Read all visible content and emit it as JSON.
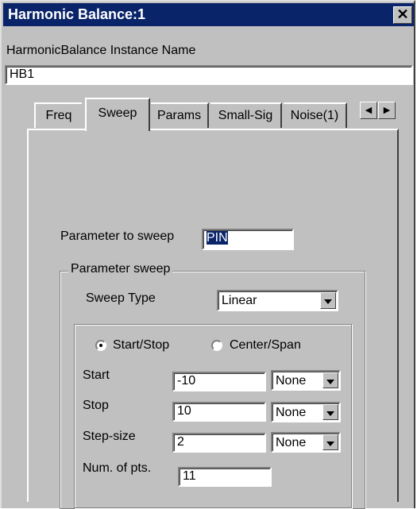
{
  "window": {
    "title": "Harmonic Balance:1",
    "close_glyph": "✕"
  },
  "instance": {
    "label": "HarmonicBalance Instance Name",
    "value": "HB1"
  },
  "tabs": {
    "items": [
      "Freq",
      "Sweep",
      "Params",
      "Small-Sig",
      "Noise(1)"
    ],
    "active": "Sweep",
    "scroll_left": "◀",
    "scroll_right": "▶"
  },
  "sweep": {
    "param_label": "Parameter to sweep",
    "param_value": "PIN",
    "group_title": "Parameter sweep",
    "type_label": "Sweep Type",
    "type_value": "Linear",
    "mode_options": [
      "Start/Stop",
      "Center/Span"
    ],
    "mode_selected": "Start/Stop",
    "rows": [
      {
        "label": "Start",
        "value": "-10",
        "unit": "None"
      },
      {
        "label": "Stop",
        "value": "10",
        "unit": "None"
      },
      {
        "label": "Step-size",
        "value": "2",
        "unit": "None"
      }
    ],
    "num_label": "Num. of pts.",
    "num_value": "11"
  }
}
